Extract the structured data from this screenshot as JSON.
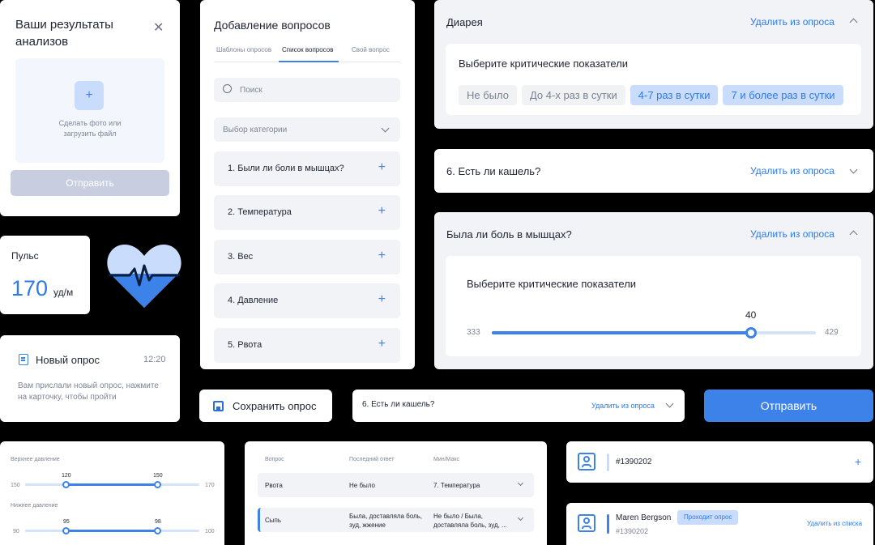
{
  "upload": {
    "title": "Ваши результаты анализов",
    "hint": "Сделать фото или загрузить файл",
    "submit": "Отправить"
  },
  "pulse": {
    "label": "Пульс",
    "value": "170",
    "unit": "уд/м"
  },
  "notification": {
    "title": "Новый опрос",
    "time": "12:20",
    "text": "Вам прислали новый опрос, нажмите на карточку, чтобы пройти"
  },
  "add_questions": {
    "title": "Добавление вопросов",
    "tabs": [
      "Шаблоны опросов",
      "Список вопросов",
      "Свой вопрос"
    ],
    "active_tab": 1,
    "search_placeholder": "Поиск",
    "category_placeholder": "Выбор категории",
    "items": [
      "1. Были ли боли в мышцах?",
      "2. Температура",
      "3. Вес",
      "4. Давление",
      "5. Рвота"
    ]
  },
  "save_button": "Сохранить опрос",
  "diarrhea": {
    "title": "Диарея",
    "remove": "Удалить из опроса",
    "subtitle": "Выберите критические показатели",
    "options": [
      "Не было",
      "До 4-х раз в сутки",
      "4-7 раз в сутки",
      "7 и более раз в сутки"
    ],
    "selected": [
      2,
      3
    ]
  },
  "cough": {
    "title": "6. Есть ли кашель?",
    "remove": "Удалить из опроса"
  },
  "muscle": {
    "title": "Была ли боль в мышцах?",
    "remove": "Удалить из опроса",
    "subtitle": "Выберите критические показатели",
    "min": "333",
    "max": "429",
    "value": "40",
    "fraction": 0.8
  },
  "cough_small": {
    "title": "6. Есть ли кашель?",
    "remove": "Удалить из опроса"
  },
  "send_button": "Отправить",
  "pressure": {
    "upper": {
      "label": "Верхнее давление",
      "min": "150",
      "max": "170",
      "low": "120",
      "high": "150",
      "low_frac": 0.24,
      "high_frac": 0.76
    },
    "lower": {
      "label": "Нижнее давление",
      "min": "90",
      "max": "100",
      "low": "95",
      "high": "98",
      "low_frac": 0.24,
      "high_frac": 0.76
    }
  },
  "table": {
    "headers": [
      "Вопрос",
      "Последний ответ",
      "Мин/Макс"
    ],
    "rows": [
      {
        "q": "Рвота",
        "last": "Не было",
        "minmax": "7. Температура"
      },
      {
        "q": "Сыпь",
        "last": "Была, доставляла боль, зуд, жжение",
        "minmax": "Не было / Была, доставляла боль, зуд, ..."
      }
    ]
  },
  "patients": [
    {
      "id": "#1390202"
    },
    {
      "name": "Maren Bergson",
      "id": "#1390202",
      "badge": "Проходит опрос",
      "action": "Удалить из списка"
    }
  ],
  "colors": {
    "accent": "#3d82e8",
    "chip": "#c9dcfb",
    "field": "#f2f3f6"
  }
}
